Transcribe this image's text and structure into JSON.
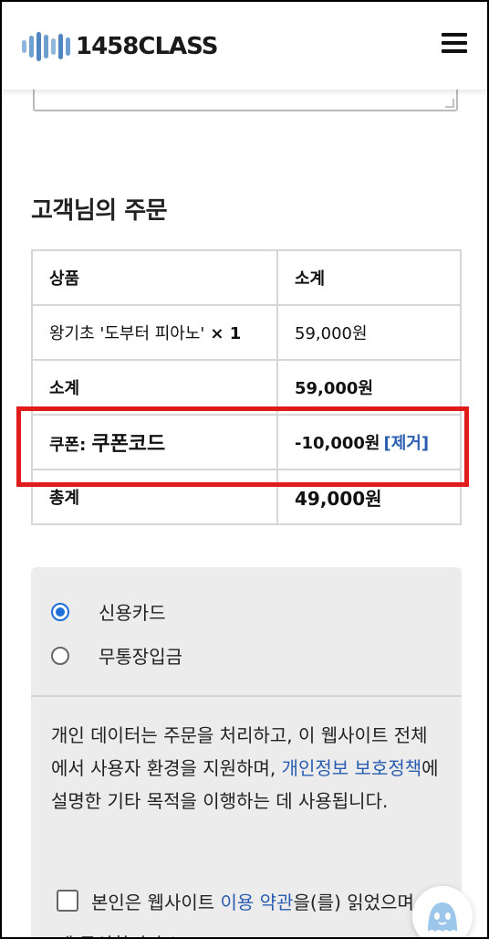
{
  "header": {
    "logo_text": "1458CLASS",
    "menu_icon": "hamburger-menu-icon"
  },
  "order": {
    "title": "고객님의 주문",
    "columns": [
      "상품",
      "소계"
    ],
    "product_name": "왕기초 '도부터 피아노'",
    "product_qty": "× 1",
    "product_price": "59,000원",
    "subtotal_label": "소계",
    "subtotal_value": "59,000원",
    "coupon_label": "쿠폰:",
    "coupon_code": "쿠폰코드",
    "coupon_value": "-10,000원",
    "coupon_remove": "[제거]",
    "total_label": "총계",
    "total_value": "49,000원"
  },
  "payment": {
    "methods": [
      {
        "label": "신용카드",
        "checked": true
      },
      {
        "label": "무통장입금",
        "checked": false
      }
    ],
    "privacy_pre": "개인 데이터는 주문을 처리하고, 이 웹사이트 전체에서 사용자 환경을 지원하며, ",
    "privacy_link": "개인정보 보호정책",
    "privacy_post": "에 설명한 기타 목적을 이행하는 데 사용됩니다.",
    "terms_pre": "본인은 웹사이트 ",
    "terms_link": "이용 약관",
    "terms_post": "을(를) 읽었으며 이에 동의합니다",
    "required_mark": "*"
  },
  "colors": {
    "accent_link": "#2a5db0",
    "highlight": "#e01b1b",
    "radio_checked": "#1e6fd9"
  }
}
